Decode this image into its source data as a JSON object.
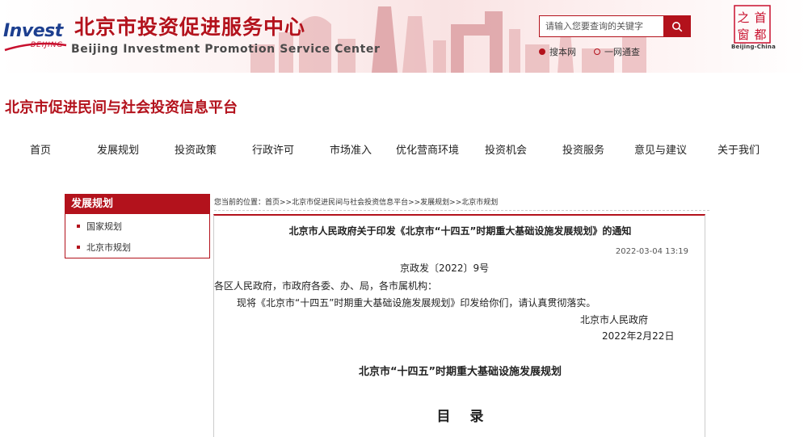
{
  "header": {
    "logo_text": "Invest",
    "logo_sub": "BEIJING",
    "title_cn": "北京市投资促进服务中心",
    "title_en": "Beijing Investment Promotion Service Center",
    "search_placeholder": "请输入您要查询的关键字",
    "radio": [
      {
        "label": "搜本网",
        "checked": true
      },
      {
        "label": "一网通查",
        "checked": false
      }
    ],
    "seal_label": "Beijing-China",
    "seal_chars": [
      "之",
      "首",
      "窗",
      "都"
    ]
  },
  "platform": {
    "title": "北京市促进民间与社会投资信息平台"
  },
  "nav": [
    "首页",
    "发展规划",
    "投资政策",
    "行政许可",
    "市场准入",
    "优化营商环境",
    "投资机会",
    "投资服务",
    "意见与建议",
    "关于我们"
  ],
  "sidebar": {
    "title": "发展规划",
    "items": [
      "国家规划",
      "北京市规划"
    ]
  },
  "breadcrumb": "您当前的位置：首页>>北京市促进民间与社会投资信息平台>>发展规划>>北京市规划",
  "article": {
    "title": "北京市人民政府关于印发《北京市“十四五”时期重大基础设施发展规划》的通知",
    "date": "2022-03-04 13:19",
    "doc_no": "京政发〔2022〕9号",
    "addressee": "各区人民政府，市政府各委、办、局，各市属机构：",
    "body": "现将《北京市“十四五”时期重大基础设施发展规划》印发给你们，请认真贯彻落实。",
    "signer": "北京市人民政府",
    "sign_date": "2022年2月22日",
    "plan_title": "北京市“十四五”时期重大基础设施发展规划",
    "toc_title": "目录"
  },
  "colors": {
    "brand_red": "#b3121c",
    "logo_blue": "#1d3f8f"
  }
}
